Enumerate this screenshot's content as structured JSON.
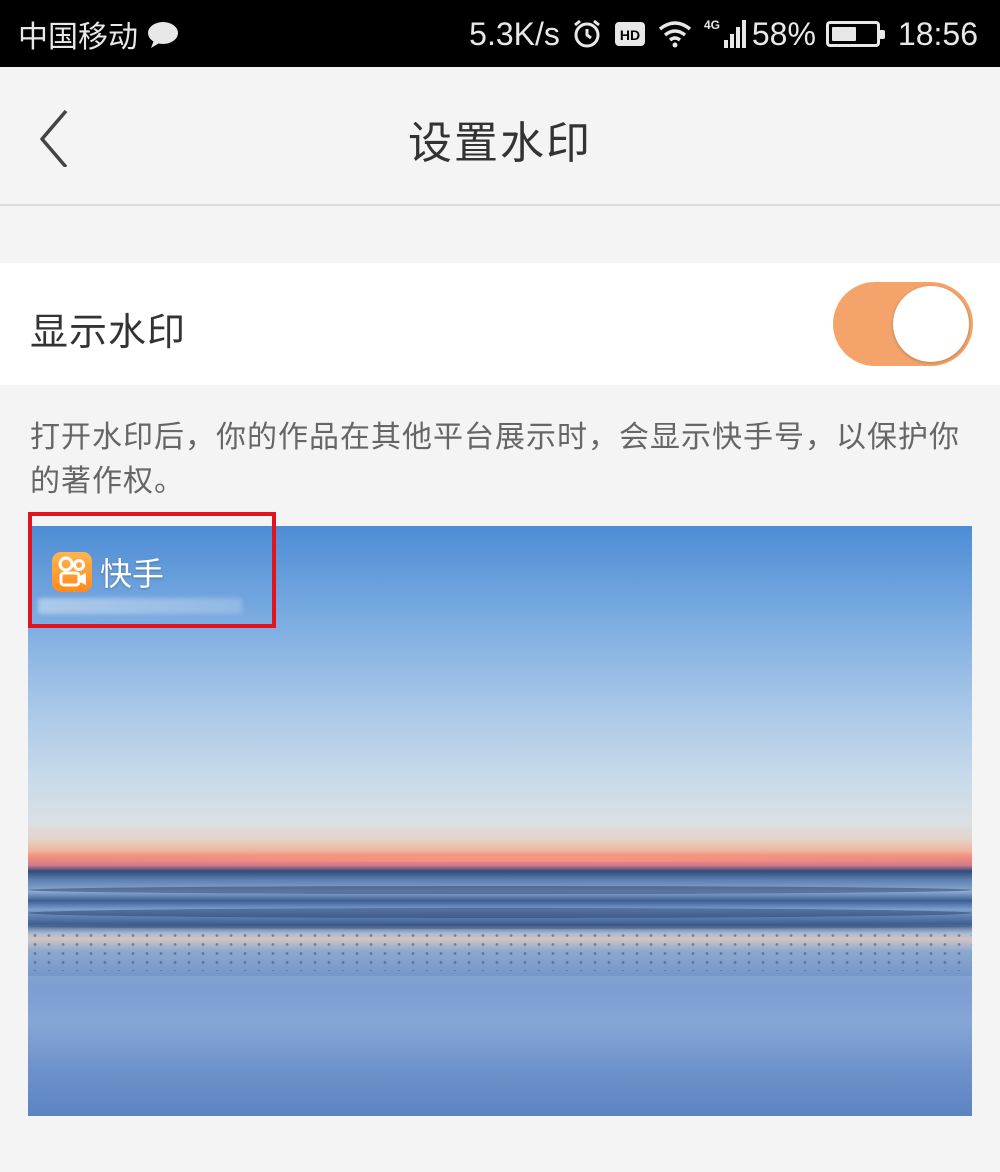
{
  "status_bar": {
    "carrier": "中国移动",
    "speed": "5.3K/s",
    "network": "4G",
    "battery": "58%",
    "battery_level": 0.58,
    "time": "18:56",
    "icons": [
      "message-bubble-icon",
      "alarm-icon",
      "hd-icon",
      "wifi-icon",
      "signal-icon",
      "battery-icon"
    ]
  },
  "nav": {
    "title": "设置水印",
    "back_icon": "chevron-left-icon"
  },
  "setting": {
    "label": "显示水印",
    "enabled": true,
    "accent": "#f4a46a"
  },
  "description": "打开水印后，你的作品在其他平台展示时，会显示快手号，以保护你的著作权。",
  "preview": {
    "watermark_text": "快手",
    "logo_icon": "kuaishou-logo-icon",
    "highlight_color": "#e0141e"
  }
}
